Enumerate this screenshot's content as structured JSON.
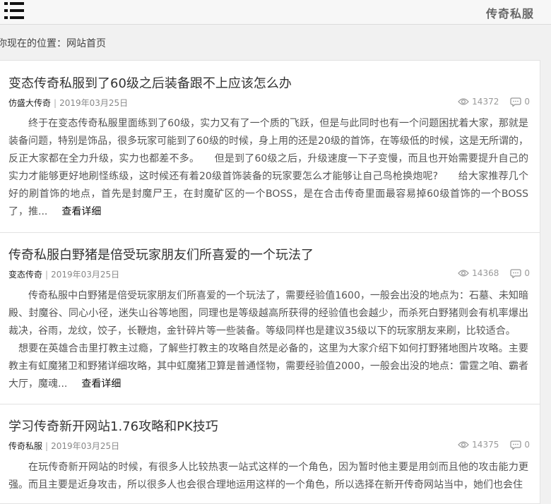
{
  "header": {
    "site_title": "传奇私服"
  },
  "breadcrumb": {
    "prefix": "你现在的位置：",
    "current": "网站首页"
  },
  "articles": [
    {
      "title": "变态传奇私服到了60级之后装备跟不上应该怎么办",
      "category": "仿盛大传奇",
      "date": "2019年03月25日",
      "views": "14372",
      "comments": "0",
      "paragraphs": [
        "终于在变态传奇私服里面练到了60级，实力又有了一个质的飞跃，但是与此同时也有一个问题困扰着大家，那就是装备问题，特别是饰品，很多玩家可能到了60级的时候，身上用的还是20级的首饰，在等级低的时候，这是无所谓的，反正大家都在全力升级，实力也都差不多。　　但是到了60级之后，升级速度一下子变慢，而且也开始需要提升自己的实力才能够更好地刷怪练级，这时候还有着20级首饰装备的玩家要怎么才能够让自己鸟枪换炮呢?　　给大家推荐几个好的刷首饰的地点，首先是封魔尸王，在封魔矿区的一个BOSS，是在合击传奇里面最容易掉60级首饰的一个BOSS了，推..."
      ],
      "readmore": "查看详细"
    },
    {
      "title": "传奇私服白野猪是倍受玩家朋友们所喜爱的一个玩法了",
      "category": "变态传奇",
      "date": "2019年03月25日",
      "views": "14368",
      "comments": "0",
      "paragraphs": [
        "传奇私服中白野猪是倍受玩家朋友们所喜爱的一个玩法了，需要经验值1600，一般会出没的地点为：石墓、未知暗殿、封魔谷、同心小径，迷失山谷等地图，同理也是等级越高所获得的经验值也会越少，而杀死白野猪则会有机率爆出裁决，谷雨，龙纹，饺子，长鞭炮，金针碎片等一些装备。等级同样也是建议35级以下的玩家朋友来刷，比较适合。",
        "想要在英雄合击里打教主过瘾，了解些打教主的攻略自然是必备的，这里为大家介绍下如何打野猪地图片攻略。主要教主有虹魔猪卫和野猪详细攻略，其中虹魔猪卫算是普通怪物，需要经验值2000，一般会出没的地点：雷霆之咱、霸者大厅，魔魂..."
      ],
      "readmore": "查看详细"
    },
    {
      "title": "学习传奇新开网站1.76攻略和PK技巧",
      "category": "传奇私服",
      "date": "2019年03月25日",
      "views": "14375",
      "comments": "0",
      "paragraphs": [
        "在玩传奇新开网站的时候，有很多人比较热衷一站式这样的一个角色，因为暂时他主要是用剑而且他的攻击能力更强。而且主要是近身攻击，所以很多人也会很合理地运用这样的一个角色，所以选择在新开传奇网站当中，她们也会住"
      ],
      "readmore": ""
    }
  ]
}
